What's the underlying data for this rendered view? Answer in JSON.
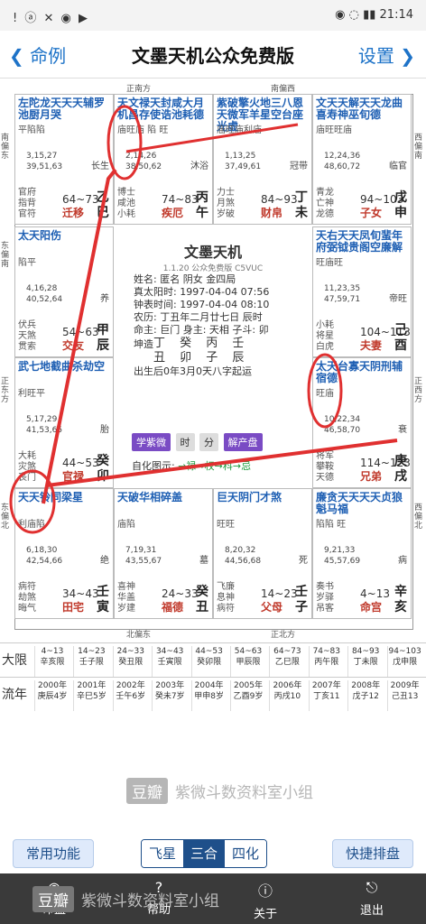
{
  "status": {
    "left": "!  ⓐ  ✕  ◉  ▶",
    "right": "◉  ◌  ▮▮  21:14"
  },
  "nav": {
    "back": "命例",
    "title": "文墨天机公众免费版",
    "settings": "设置"
  },
  "palaces": [
    {
      "stars": "左陀龙天天天辅罗池厨月哭",
      "bright": "平陷陷",
      "ages": "3,15,27\n39,51,63",
      "stage": "长生",
      "gods": "官府\n指背\n官符",
      "range": "64~73",
      "name": "迁移",
      "stem": "乙",
      "branch": "巳"
    },
    {
      "stars": "天文禄天封咸大月机昌存使诰池耗德",
      "bright": "庙旺庙 陷 旺",
      "ages": "2,14,26\n38,50,62",
      "stage": "沐浴",
      "gods": "博士\n咸池\n小耗",
      "range": "74~83",
      "name": "疾厄",
      "stem": "丙",
      "branch": "午"
    },
    {
      "stars": "紫破擎火地三八恩天微军羊星空台座光虚",
      "bright": "庙旺庙利庙",
      "ages": "1,13,25\n37,49,61",
      "stage": "冠带",
      "gods": "力士\n月煞\n岁破",
      "range": "84~93",
      "name": "财帛",
      "stem": "丁",
      "branch": "未"
    },
    {
      "stars": "文天天解天天龙曲喜寿神巫旬德",
      "bright": "庙旺旺庙",
      "ages": "12,24,36\n48,60,72",
      "stage": "临官",
      "gods": "青龙\n亡神\n龙德",
      "range": "94~103",
      "name": "子女",
      "stem": "戊",
      "branch": "申"
    },
    {
      "stars": "太天阳伤",
      "bright": "陷平",
      "ages": "4,16,28\n40,52,64",
      "stage": "养",
      "gods": "伏兵\n天煞\n贯索",
      "range": "54~63",
      "name": "交友",
      "stem": "甲",
      "branch": "辰"
    },
    {
      "stars": "天右天天凤旬蜚年府弼钺贵阁空廉解",
      "bright": "旺庙旺",
      "ages": "11,23,35\n47,59,71",
      "stage": "帝旺",
      "gods": "小耗\n将星\n白虎",
      "range": "104~113",
      "name": "夫妻",
      "stem": "己",
      "branch": "酉"
    },
    {
      "stars": "武七地截曲杀劫空",
      "bright": "利旺平",
      "ages": "5,17,29\n41,53,65",
      "stage": "胎",
      "gods": "大耗\n灾煞\n丧门",
      "range": "44~53",
      "name": "官禄",
      "stem": "癸",
      "branch": "卯"
    },
    {
      "stars": "太天台寡天阴刑辅宿德",
      "bright": "旺庙",
      "ages": "10,22,34\n46,58,70",
      "stage": "衰",
      "gods": "将军\n攀鞍\n天德",
      "range": "114~123",
      "name": "兄弟",
      "stem": "庚",
      "branch": "戌"
    },
    {
      "stars": "天天铃同梁星",
      "bright": "利庙陷",
      "ages": "6,18,30\n42,54,66",
      "stage": "绝",
      "gods": "病符\n劫煞\n晦气",
      "range": "34~43",
      "name": "田宅",
      "stem": "壬",
      "branch": "寅"
    },
    {
      "stars": "天破华相碎盖",
      "bright": "庙陷",
      "ages": "7,19,31\n43,55,67",
      "stage": "墓",
      "gods": "喜神\n华盖\n岁建",
      "range": "24~33",
      "name": "福德",
      "stem": "癸",
      "branch": "丑"
    },
    {
      "stars": "巨天阴门才煞",
      "bright": "旺旺",
      "ages": "8,20,32\n44,56,68",
      "stage": "死",
      "gods": "飞廉\n息神\n病符",
      "range": "14~23",
      "name": "父母",
      "stem": "壬",
      "branch": "子"
    },
    {
      "stars": "廉贪天天天天贞狼魁马福",
      "bright": "陷陷 旺",
      "ages": "9,21,33\n45,57,69",
      "stage": "病",
      "gods": "奏书\n岁驿\n吊客",
      "range": "4~13",
      "name": "命宫",
      "stem": "辛",
      "branch": "亥"
    }
  ],
  "center": {
    "title": "文墨天机",
    "version": "1.1.20 公众免费版  C5VUC",
    "lines": [
      "姓名: 匿名      阴女 金四局",
      "真太阳时: 1997-04-04  07:56",
      "钟表时间: 1997-04-04  08:10",
      "农历: 丁丑年二月廿七日 辰时",
      "命主: 巨门 身主: 天相 子斗: 卯"
    ],
    "bazi_label": "坤造",
    "bazi_stems": "丁 癸 丙 壬",
    "bazi_branches": "丑 卯 子 辰",
    "note": "出生后0年3月0天八字起运",
    "btn1": "学紫微",
    "btn2": "时",
    "btn3": "分",
    "btn4": "解产盘",
    "hua": "自化图示:",
    "hua_items": "→禄→权→科→忌"
  },
  "dirs": {
    "top1": "正南方",
    "top2": "南偏西",
    "bottom1": "北偏东",
    "bottom2": "正北方",
    "left1": "南偏东",
    "left2": "东偏南",
    "left3": "正东方",
    "left4": "东偏北",
    "right1": "西偏南",
    "right2": "正西方",
    "right3": "西偏北"
  },
  "limits": {
    "row1_head": "大限",
    "row2_head": "流年",
    "row1": [
      [
        "4~13",
        "辛亥限"
      ],
      [
        "14~23",
        "壬子限"
      ],
      [
        "24~33",
        "癸丑限"
      ],
      [
        "34~43",
        "壬寅限"
      ],
      [
        "44~53",
        "癸卯限"
      ],
      [
        "54~63",
        "甲辰限"
      ],
      [
        "64~73",
        "乙巳限"
      ],
      [
        "74~83",
        "丙午限"
      ],
      [
        "84~93",
        "丁未限"
      ],
      [
        "94~103",
        "戊申限"
      ]
    ],
    "row2": [
      [
        "2000年",
        "庚辰4岁"
      ],
      [
        "2001年",
        "辛巳5岁"
      ],
      [
        "2002年",
        "壬午6岁"
      ],
      [
        "2003年",
        "癸未7岁"
      ],
      [
        "2004年",
        "甲申8岁"
      ],
      [
        "2005年",
        "乙酉9岁"
      ],
      [
        "2006年",
        "丙戌10"
      ],
      [
        "2007年",
        "丁亥11"
      ],
      [
        "2008年",
        "戊子12"
      ],
      [
        "2009年",
        "己丑13"
      ]
    ]
  },
  "toolbar": {
    "common": "常用功能",
    "seg": [
      "飞星",
      "三合",
      "四化"
    ],
    "active": "三合",
    "quick": "快捷排盘"
  },
  "tabs": [
    {
      "label": "命盘",
      "icon": "◉"
    },
    {
      "label": "帮助",
      "icon": "?"
    },
    {
      "label": "关于",
      "icon": "ⓘ"
    },
    {
      "label": "退出",
      "icon": "⎋"
    }
  ],
  "watermarks": {
    "logo": "豆瓣",
    "text": "紫微斗数资料室小组"
  }
}
